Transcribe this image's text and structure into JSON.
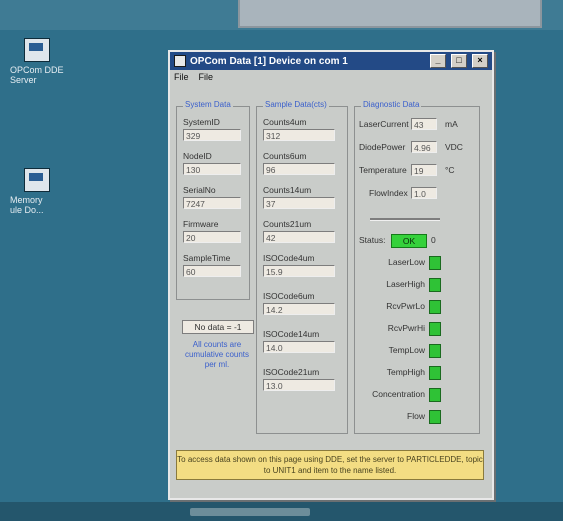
{
  "desktop": {
    "icons": [
      {
        "label_lines": [
          "OPCom DDE",
          "Server"
        ]
      },
      {
        "label_lines": [
          "Memory",
          "ule Do..."
        ]
      }
    ]
  },
  "window": {
    "title": "OPCom Data [1] Device on com 1",
    "menu": [
      "File",
      "File"
    ],
    "title_buttons": [
      "_",
      "□",
      "×"
    ]
  },
  "system_data": {
    "legend": "System Data",
    "fields": [
      {
        "label": "SystemID",
        "value": "329"
      },
      {
        "label": "NodeID",
        "value": "130"
      },
      {
        "label": "SerialNo",
        "value": "7247"
      },
      {
        "label": "Firmware",
        "value": "20"
      },
      {
        "label": "SampleTime",
        "value": "60"
      }
    ]
  },
  "sample_data": {
    "legend": "Sample Data(cts)",
    "fields": [
      {
        "label": "Counts4um",
        "value": "312"
      },
      {
        "label": "Counts6um",
        "value": "96"
      },
      {
        "label": "Counts14um",
        "value": "37"
      },
      {
        "label": "Counts21um",
        "value": "42"
      },
      {
        "label": "ISOCode4um",
        "value": "15.9"
      },
      {
        "label": "ISOCode6um",
        "value": "14.2"
      },
      {
        "label": "ISOCode14um",
        "value": "14.0"
      },
      {
        "label": "ISOCode21um",
        "value": "13.0"
      }
    ]
  },
  "diagnostic_data": {
    "legend": "Diagnostic Data",
    "fields": [
      {
        "label": "LaserCurrent",
        "value": "43",
        "unit": "mA"
      },
      {
        "label": "DiodePower",
        "value": "4.96",
        "unit": "VDC"
      },
      {
        "label": "Temperature",
        "value": "19",
        "unit": "°C"
      },
      {
        "label": "FlowIndex",
        "value": "1.0",
        "unit": ""
      }
    ],
    "status_label": "Status:",
    "status_value": "OK",
    "status_code": "0",
    "indicators": [
      "LaserLow",
      "LaserHigh",
      "RcvPwrLo",
      "RcvPwrHi",
      "TempLow",
      "TempHigh",
      "Concentration",
      "Flow"
    ]
  },
  "no_data": "No data = -1",
  "note": "All counts are cumulative counts per ml.",
  "info": "To access data shown on this page using DDE, set the server to PARTICLEDDE, topic to UNIT1 and item to the name listed.",
  "colors": {
    "desktop": "#2f6f8a",
    "titlebar": "#234a86",
    "led_green": "#2fc236",
    "info_bg": "#f3dd83",
    "legend_blue": "#3a5fcc"
  }
}
